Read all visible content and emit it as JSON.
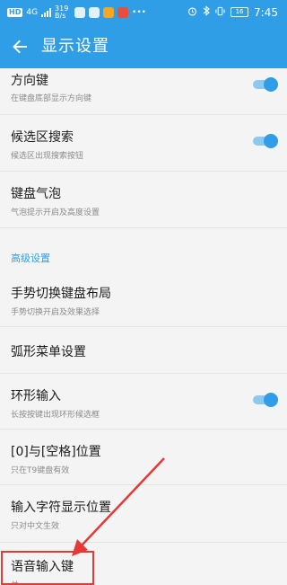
{
  "status_bar": {
    "hd_badge": "HD",
    "signal_label": "4G",
    "speed": "319 B/s",
    "time": "7:45",
    "battery": "16"
  },
  "header": {
    "title": "显示设置"
  },
  "settings": [
    {
      "title": "方向键",
      "subtitle": "在键盘底部显示方向键",
      "toggle": true
    },
    {
      "title": "候选区搜索",
      "subtitle": "候选区出现搜索按钮",
      "toggle": true
    },
    {
      "title": "键盘气泡",
      "subtitle": "气泡提示开启及高度设置"
    }
  ],
  "advanced": {
    "section_title": "高级设置",
    "items": [
      {
        "title": "手势切换键盘布局",
        "subtitle": "手势切换开启及效果选择"
      },
      {
        "title": "弧形菜单设置"
      },
      {
        "title": "环形输入",
        "subtitle": "长按按键出现环形候选框",
        "toggle": true
      },
      {
        "title": "[0]与[空格]位置",
        "subtitle": "只在T9键盘有效"
      },
      {
        "title": "输入字符显示位置",
        "subtitle": "只对中文生效"
      },
      {
        "title": "语音输入键",
        "subtitle": "关"
      }
    ]
  },
  "colors": {
    "accent": "#2f9ee6",
    "highlight": "#e53935"
  }
}
